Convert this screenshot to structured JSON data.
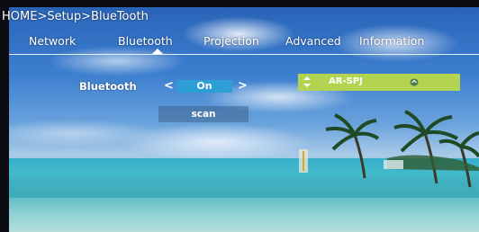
{
  "breadcrumb": "HOME>Setup>BlueTooth",
  "tabs": [
    {
      "label": "Network"
    },
    {
      "label": "Bluetooth",
      "selected": true
    },
    {
      "label": "Projection"
    },
    {
      "label": "Advanced"
    },
    {
      "label": "Information"
    }
  ],
  "bluetooth_setting": {
    "label": "Bluetooth",
    "value": "On",
    "prev_arrow": "<",
    "next_arrow": ">"
  },
  "scan_button": {
    "label": "scan"
  },
  "device_list": [
    {
      "name": "AR-SPJ",
      "icons": [
        "sort-arrows-icon",
        "link-icon"
      ]
    }
  ],
  "colors": {
    "selected_value_bg": "#2e9fd6",
    "device_highlight_bg": "#b2d451"
  }
}
